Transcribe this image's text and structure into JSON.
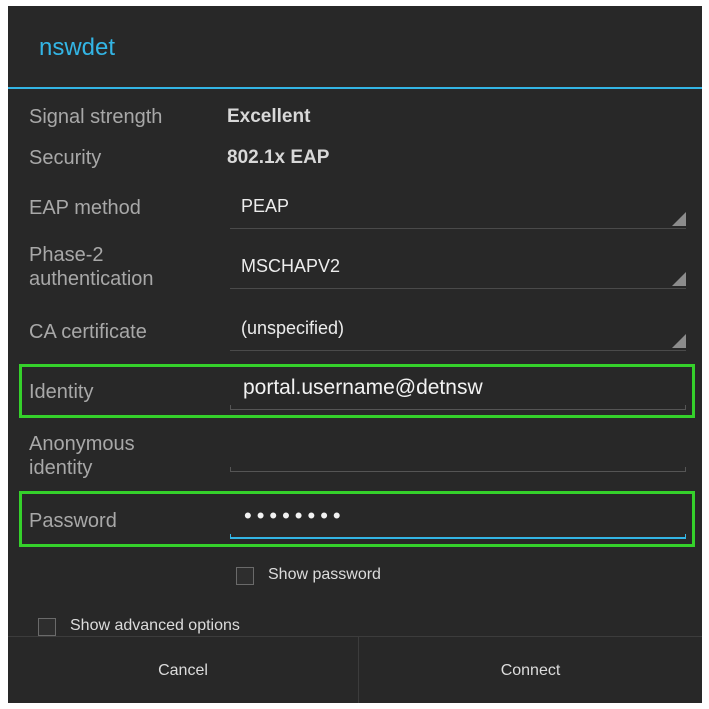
{
  "dialog": {
    "title": "nswdet",
    "accent_color": "#33b5e5",
    "highlight_color": "#35d12b"
  },
  "fields": {
    "signal_strength": {
      "label": "Signal strength",
      "value": "Excellent"
    },
    "security": {
      "label": "Security",
      "value": "802.1x EAP"
    },
    "eap_method": {
      "label": "EAP method",
      "value": "PEAP"
    },
    "phase2": {
      "label_line1": "Phase-2",
      "label_line2": "authentication",
      "value": "MSCHAPV2"
    },
    "ca_certificate": {
      "label": "CA certificate",
      "value": "(unspecified)"
    },
    "identity": {
      "label": "Identity",
      "value": "portal.username@detnsw"
    },
    "anonymous_identity": {
      "label_line1": "Anonymous",
      "label_line2": "identity",
      "value": ""
    },
    "password": {
      "label": "Password",
      "value": "••••••••"
    }
  },
  "checkboxes": {
    "show_password": {
      "label": "Show password",
      "checked": false
    },
    "show_advanced": {
      "label": "Show advanced options",
      "checked": false
    }
  },
  "buttons": {
    "cancel": "Cancel",
    "connect": "Connect"
  }
}
